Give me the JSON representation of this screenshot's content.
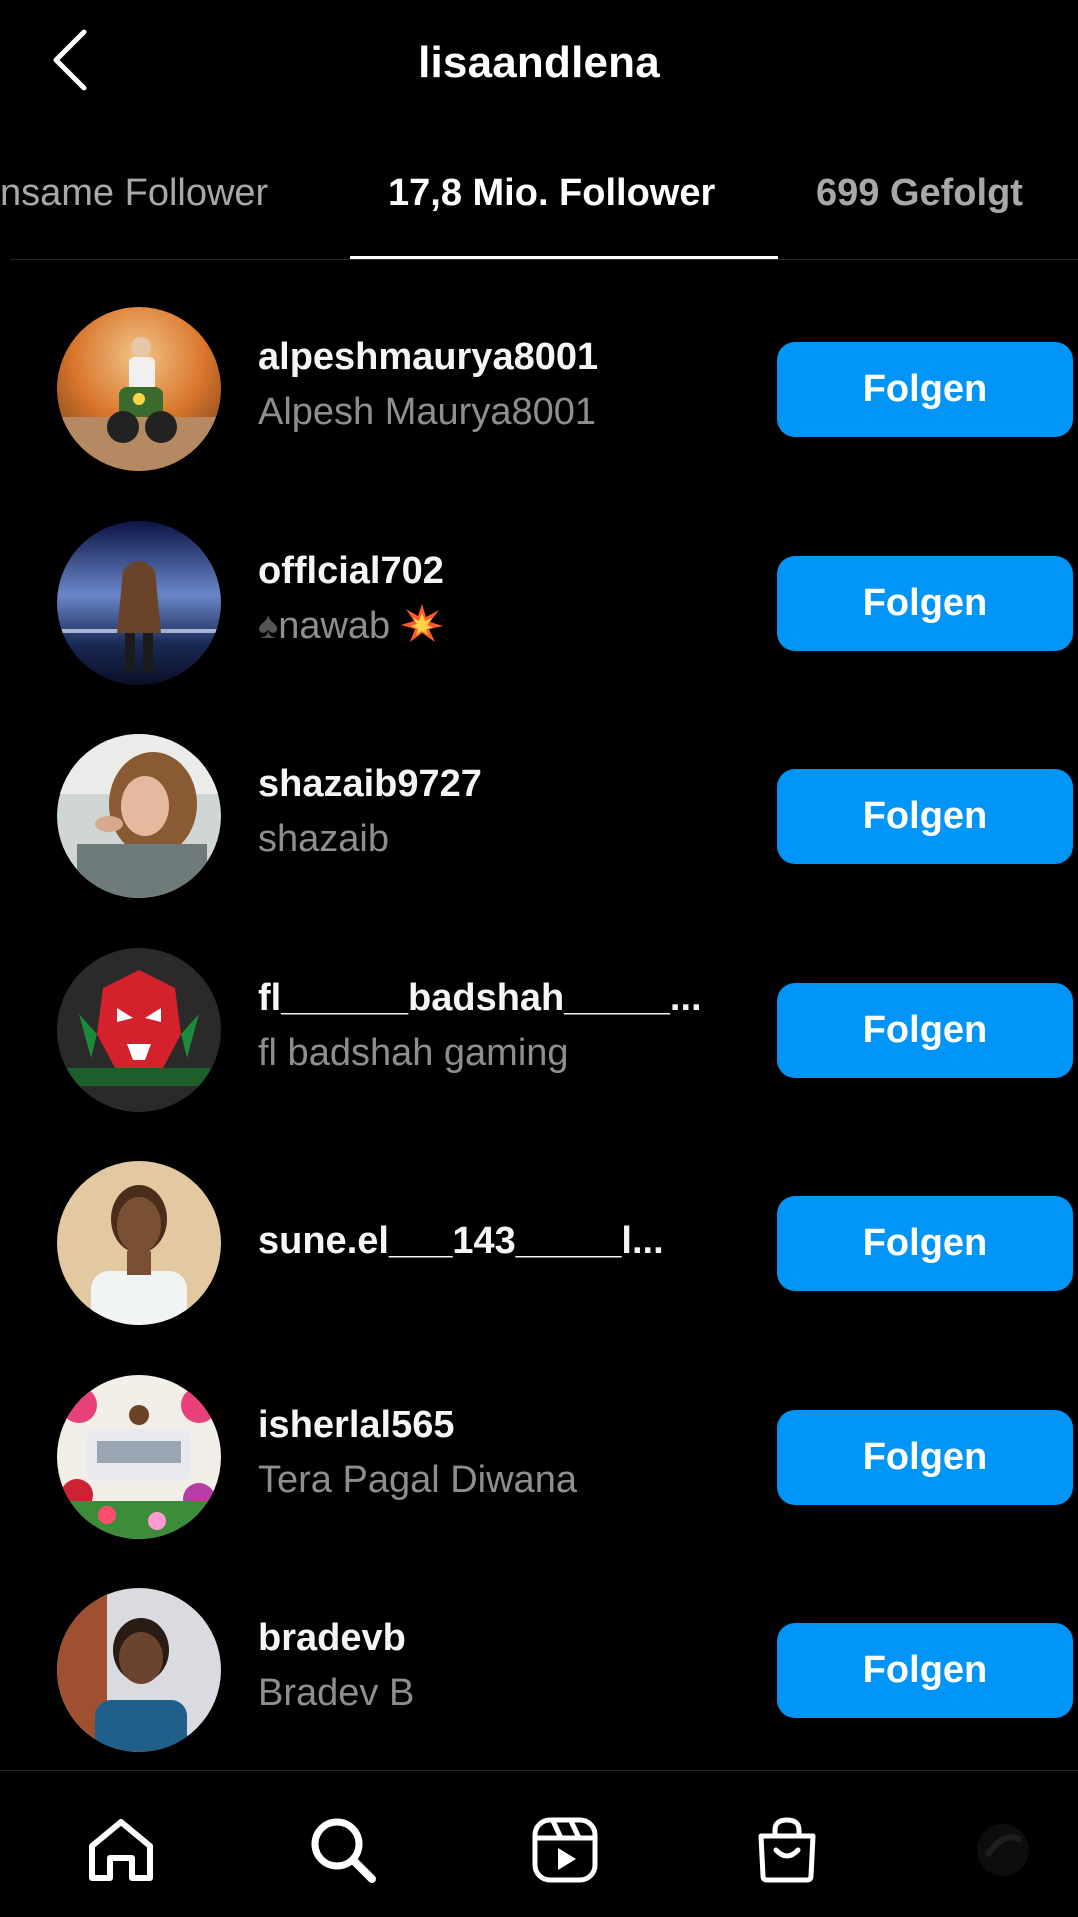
{
  "header": {
    "title": "lisaandlena",
    "back_icon": "chevron-left-icon"
  },
  "tabs": [
    {
      "label": "Gemeinsame Follower",
      "visible_label": "nsame Follower",
      "active": false
    },
    {
      "label": "17,8 Mio. Follower",
      "active": true
    },
    {
      "label": "699 Gefolgt",
      "active": false
    }
  ],
  "followers": [
    {
      "username": "alpeshmaurya8001",
      "fullname": "Alpesh Maurya8001",
      "button": "Folgen"
    },
    {
      "username": "offlcial702",
      "fullname": "nawab",
      "fullname_prefix_icon": "spade-icon",
      "fullname_suffix_icon": "collision-icon",
      "button": "Folgen"
    },
    {
      "username": "shazaib9727",
      "fullname": "shazaib",
      "button": "Folgen"
    },
    {
      "username": "fl______badshah_____...",
      "fullname": "fl badshah gaming",
      "button": "Folgen"
    },
    {
      "username": "sune.el___143_____l...",
      "fullname": "",
      "button": "Folgen"
    },
    {
      "username": "isherlal565",
      "fullname": "Tera Pagal Diwana",
      "button": "Folgen"
    },
    {
      "username": "bradevb",
      "fullname": "Bradev B",
      "button": "Folgen"
    }
  ],
  "bottom_nav": [
    {
      "name": "home",
      "icon": "home-icon"
    },
    {
      "name": "search",
      "icon": "search-icon"
    },
    {
      "name": "reels",
      "icon": "reels-icon"
    },
    {
      "name": "shop",
      "icon": "shopping-bag-icon"
    },
    {
      "name": "profile",
      "icon": "profile-avatar"
    }
  ],
  "colors": {
    "background": "#000000",
    "primary_button": "#0095f6",
    "secondary_text": "#8e8e8e",
    "tab_inactive": "#a8a8a8"
  }
}
